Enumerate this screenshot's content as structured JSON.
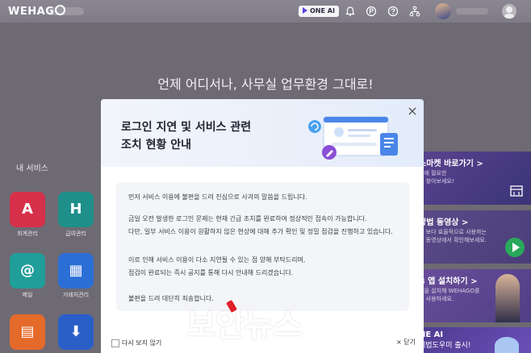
{
  "topbar": {
    "logo": "WEHAG",
    "oneai_badge": "ONE AI",
    "icons": [
      "bell-icon",
      "p-icon",
      "help-icon",
      "org-icon"
    ]
  },
  "hero": {
    "text": "언제 어디서나, 사무실 업무환경 그대로!"
  },
  "my_services": {
    "title": "내 서비스",
    "apps": [
      {
        "label": "회계관리",
        "glyph": "A",
        "color": "#d6304a"
      },
      {
        "label": "급여관리",
        "glyph": "H",
        "color": "#1f8f8a"
      },
      {
        "label": "메일",
        "glyph": "@",
        "color": "#1f9e9a"
      },
      {
        "label": "거래처관리",
        "glyph": "▦",
        "color": "#2b6fd6"
      },
      {
        "label": "",
        "glyph": "▤",
        "color": "#e46a2a"
      },
      {
        "label": "",
        "glyph": "⬇",
        "color": "#2a5fc8"
      }
    ]
  },
  "right_cards": [
    {
      "title": "스마켓 바로가기 >",
      "sub": "스에 필요한\n를 찾아보세요!"
    },
    {
      "title": "방법 동영상 >",
      "sub": "를 보다 효율적으로 사용하는\n트 동영상에서 확인해보세요."
    },
    {
      "title": "B 앱 설치하기 >",
      "sub": "앱을 설치해 WEHAGO를\n게 사용하세요."
    },
    {
      "title": "NE AI",
      "sub": "세법도우미 출시!"
    }
  ],
  "modal": {
    "title_line1": "로그인 지연 및 서비스 관련",
    "title_line2": "조치 현황 안내",
    "close_symbol": "×",
    "message": [
      "먼저 서비스 이용에 불편을 드려 진심으로 사과의 말씀을 드립니다.",
      "금일 오전 발생한 로그인 문제는 현재 긴급 조치를 완료하여 정상적인 접속이 가능합니다.",
      "다만, 일부 서비스 이용이 원활하지 않은 현상에 대해 추가 확인 및 정밀 점검을 진행하고 있습니다.",
      "이로 인해 서비스 이용이 다소 지연될 수 있는 점 양해 부탁드리며,",
      "점검이 완료되는 즉시 공지를 통해 다시 안내해 드리겠습니다.",
      "불편을 드려 대단히 죄송합니다."
    ],
    "dont_show_label": "다시 보지 않기",
    "close_label": "× 닫기"
  },
  "watermark": "보안뉴스",
  "colors": {
    "overlay": "#6e6a73",
    "modal_head_gradient_start": "#f3f5fb",
    "modal_head_gradient_end": "#e3ecfa",
    "watermark_dot": "#e0202a"
  }
}
